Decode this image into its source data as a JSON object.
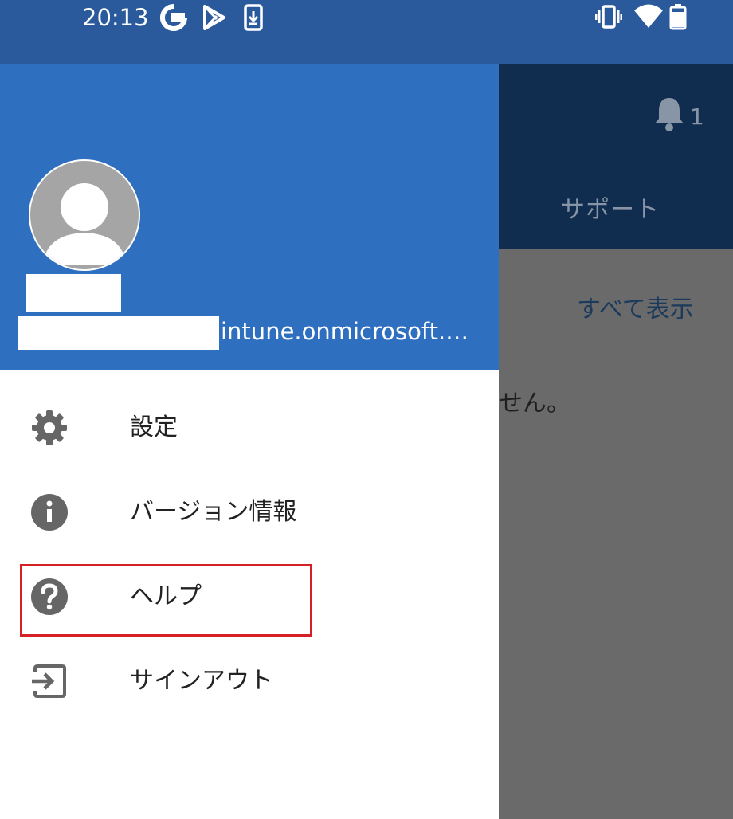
{
  "status_bar": {
    "time": "20:13",
    "left_icons": [
      "google-icon",
      "play-store-icon",
      "download-icon"
    ],
    "right_icons": [
      "vibrate-icon",
      "wifi-icon",
      "battery-icon"
    ]
  },
  "background": {
    "notification_count": "1",
    "tab_label": "サポート",
    "show_all_label": "すべて表示",
    "content_text_fragment": "せん。"
  },
  "drawer": {
    "email_suffix": "intune.onmicrosoft.…",
    "menu": [
      {
        "icon": "gear-icon",
        "label": "設定"
      },
      {
        "icon": "info-icon",
        "label": "バージョン情報"
      },
      {
        "icon": "help-icon",
        "label": "ヘルプ"
      },
      {
        "icon": "sign-out-icon",
        "label": "サインアウト"
      }
    ]
  },
  "colors": {
    "status_bar": "#2b5a9c",
    "drawer_header": "#2f6fc0",
    "highlight": "#d62028"
  }
}
